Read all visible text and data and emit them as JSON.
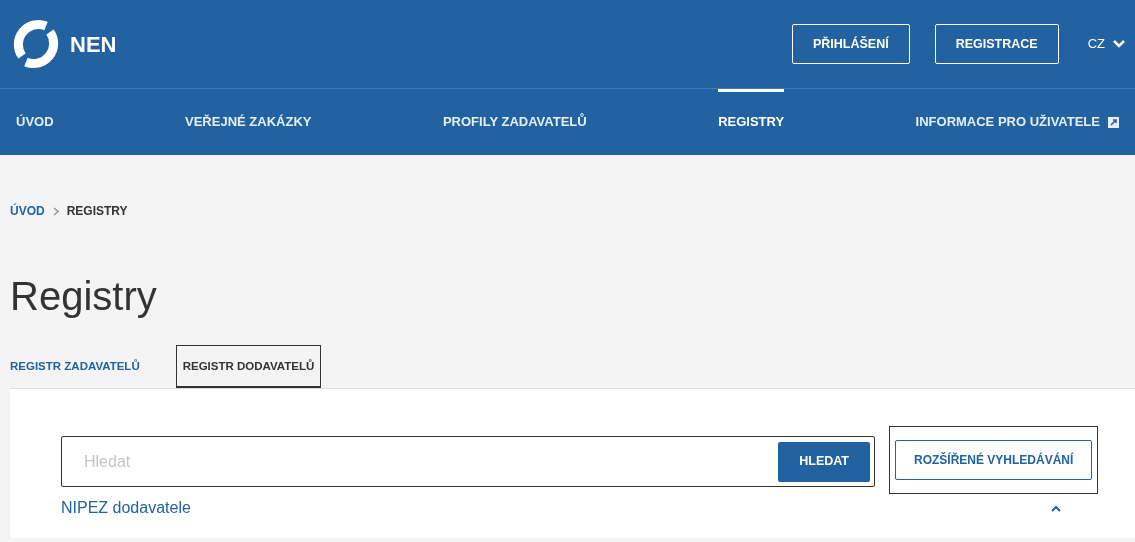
{
  "header": {
    "logo": "NEN",
    "buttons": [
      "PŘIHLÁŠENÍ",
      "REGISTRACE"
    ],
    "language": "CZ"
  },
  "nav": [
    {
      "label": "ÚVOD",
      "selected": false,
      "external": false
    },
    {
      "label": "VEŘEJNÉ ZAKÁZKY",
      "selected": false,
      "external": false
    },
    {
      "label": "PROFILY ZADAVATELŮ",
      "selected": false,
      "external": false
    },
    {
      "label": "REGISTRY",
      "selected": true,
      "external": false
    },
    {
      "label": "INFORMACE PRO UŽIVATELE",
      "selected": false,
      "external": true
    }
  ],
  "breadcrumb": [
    {
      "label": "ÚVOD",
      "current": false
    },
    {
      "label": "REGISTRY",
      "current": true
    }
  ],
  "title": "Registry",
  "tabs": [
    {
      "label": "REGISTR ZADAVATELŮ",
      "selected": false
    },
    {
      "label": "REGISTR DODAVATELŮ",
      "selected": true
    }
  ],
  "search": {
    "placeholder": "Hledat",
    "button": "HLEDAT",
    "advanced": "ROZŠÍŘENÉ VYHLEDÁVÁNÍ"
  },
  "section": {
    "label": "NIPEZ dodavatele",
    "expanded": true
  }
}
